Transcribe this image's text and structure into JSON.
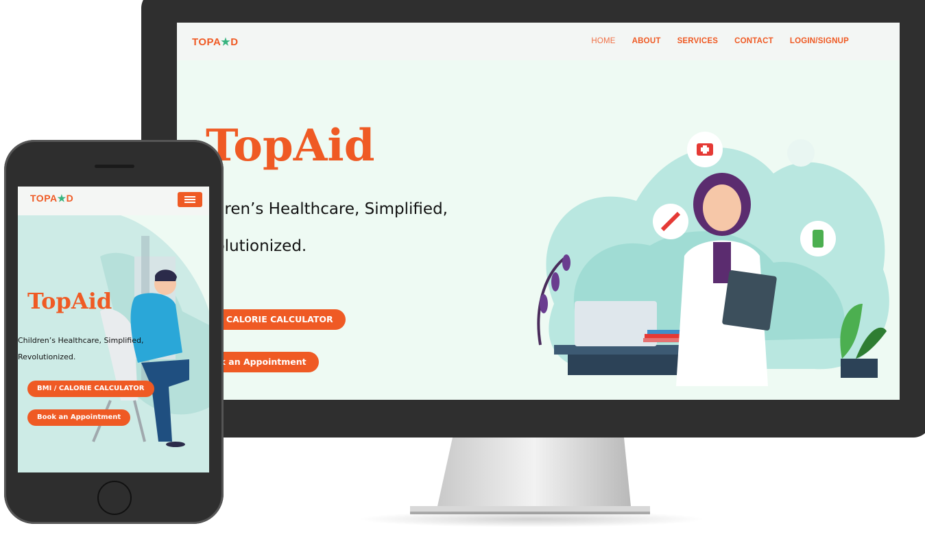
{
  "desktop": {
    "logo": {
      "text": "TOPA",
      "figure": "★",
      "suffix": "D"
    },
    "nav": {
      "home": "HOME",
      "about": "ABOUT",
      "services": "SERVICES",
      "contact": "CONTACT",
      "login": "LOGIN/SIGNUP"
    },
    "hero": {
      "title": "TopAid",
      "subtitle_line1": "ildren’s Healthcare, Simplified,",
      "subtitle_line2": "volutionized.",
      "button_calculator": "I / CALORIE CALCULATOR",
      "button_appointment": "ok an Appointment"
    }
  },
  "mobile": {
    "logo": {
      "text": "TOPA",
      "figure": "★",
      "suffix": "D"
    },
    "hero": {
      "title": "TopAid",
      "subtitle_line1": "Children’s Healthcare, Simplified,",
      "subtitle_line2": "Revolutionized.",
      "button_calculator": "BMI / CALORIE CALCULATOR",
      "button_appointment": "Book an Appointment"
    }
  },
  "colors": {
    "accent": "#ef5a24",
    "screen_bg": "#eefaf3",
    "device_frame": "#2f2f2f",
    "illustration_teal": "#7fd3c8"
  }
}
